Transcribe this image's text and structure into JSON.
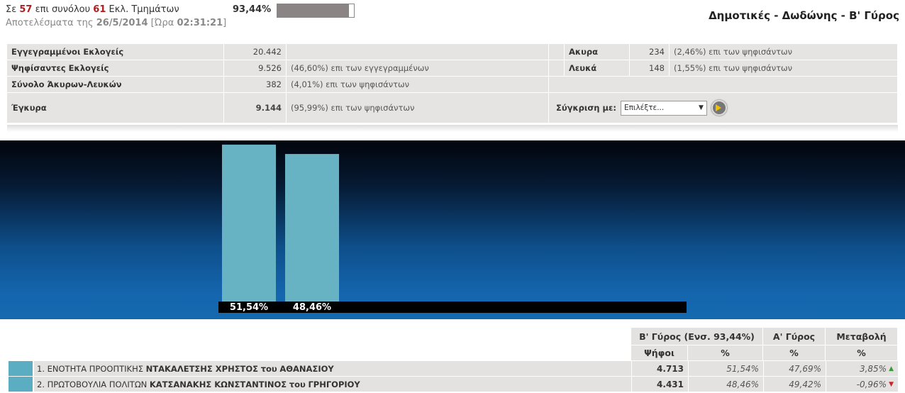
{
  "header": {
    "prefix": "Σε",
    "counted": "57",
    "middle": "επι συνόλου",
    "total": "61",
    "suffix": "Εκλ. Τμημάτων",
    "percent_text": "93,44%",
    "progress_fraction": 0.9344,
    "results_label": "Αποτελέσματα της",
    "date": "26/5/2014",
    "time_label": "[Ώρα",
    "time": "02:31:21",
    "time_close": "]",
    "title": "Δημοτικές - Δωδώνης - Β' Γύρος"
  },
  "stats": {
    "registered_label": "Εγγεγραμμένοι Εκλογείς",
    "registered_value": "20.442",
    "voted_label": "Ψηφίσαντες Εκλογείς",
    "voted_value": "9.526",
    "voted_desc": "(46,60%) επι των εγγεγραμμένων",
    "invalid_blank_label": "Σύνολο Άκυρων-Λευκών",
    "invalid_blank_value": "382",
    "invalid_blank_desc": "(4,01%) επι των ψηφισάντων",
    "valid_label": "Έγκυρα",
    "valid_value": "9.144",
    "valid_desc": "(95,99%) επι των ψηφισάντων",
    "invalid_label": "Ακυρα",
    "invalid_value": "234",
    "invalid_desc": "(2,46%) επι των ψηφισάντων",
    "blank_label": "Λευκά",
    "blank_value": "148",
    "blank_desc": "(1,55%) επι των ψηφισάντων",
    "compare_label": "Σύγκριση με:",
    "compare_select": "Επιλέξτε..."
  },
  "chart_data": {
    "type": "bar",
    "categories": [
      "ΝΤΑΚΑΛΕΤΣΗΣ ΧΡΗΣΤΟΣ",
      "ΚΑΤΣΑΝΑΚΗΣ ΚΩΝΣΤΑΝΤΙΝΟΣ"
    ],
    "values": [
      51.54,
      48.46
    ],
    "value_labels": [
      "51,54%",
      "48,46%"
    ],
    "ylim": [
      0,
      55
    ],
    "bar_color": "#67b3c3"
  },
  "results": {
    "round2_header": "Β' Γύρος  (Ενσ. 93,44%)",
    "round1_header": "Α' Γύρος",
    "change_header": "Μεταβολή",
    "votes_sub": "Ψήφοι",
    "pct_sub": "%",
    "pct_sub2": "%",
    "pct_sub3": "%",
    "rows": [
      {
        "num": "1.",
        "party": "ΕΝΟΤΗΤΑ ΠΡΟΟΠΤΙΚΗΣ",
        "candidate": "ΝΤΑΚΑΛΕΤΣΗΣ ΧΡΗΣΤΟΣ",
        "of": "του",
        "father": "ΑΘΑΝΑΣΙΟΥ",
        "votes": "4.713",
        "pct": "51,54%",
        "pct_r1": "47,69%",
        "change": "3,85%",
        "trend": "▲"
      },
      {
        "num": "2.",
        "party": "ΠΡΩΤΟΒΟΥΛΙΑ ΠΟΛΙΤΩΝ",
        "candidate": "ΚΑΤΣΑΝΑΚΗΣ ΚΩΝΣΤΑΝΤΙΝΟΣ",
        "of": "του",
        "father": "ΓΡΗΓΟΡΙΟΥ",
        "votes": "4.431",
        "pct": "48,46%",
        "pct_r1": "49,42%",
        "change": "-0,96%",
        "trend": "▼"
      }
    ]
  }
}
